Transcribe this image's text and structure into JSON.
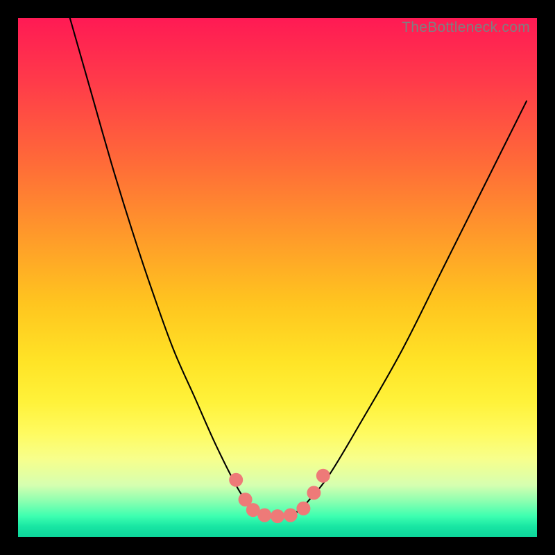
{
  "watermark": "TheBottleneck.com",
  "chart_data": {
    "type": "line",
    "title": "",
    "xlabel": "",
    "ylabel": "",
    "xlim": [
      0,
      100
    ],
    "ylim": [
      0,
      100
    ],
    "series": [
      {
        "name": "bottleneck-curve",
        "x": [
          10,
          14,
          18,
          22,
          26,
          30,
          34,
          38,
          42,
          44,
          46,
          48,
          50,
          52,
          54,
          56,
          60,
          66,
          74,
          82,
          90,
          98
        ],
        "values": [
          100,
          86,
          72,
          59,
          47,
          36,
          27,
          18,
          10,
          7,
          5,
          4,
          4,
          4,
          5,
          7,
          12,
          22,
          36,
          52,
          68,
          84
        ]
      }
    ],
    "markers": [
      {
        "name": "dot-left-1",
        "x": 42.0,
        "y": 11.0
      },
      {
        "name": "dot-left-2",
        "x": 43.8,
        "y": 7.2
      },
      {
        "name": "dot-left-3",
        "x": 45.3,
        "y": 5.2
      },
      {
        "name": "dot-mid-1",
        "x": 47.5,
        "y": 4.2
      },
      {
        "name": "dot-mid-2",
        "x": 50.0,
        "y": 4.0
      },
      {
        "name": "dot-mid-3",
        "x": 52.5,
        "y": 4.2
      },
      {
        "name": "dot-right-1",
        "x": 55.0,
        "y": 5.5
      },
      {
        "name": "dot-right-2",
        "x": 57.0,
        "y": 8.5
      },
      {
        "name": "dot-right-3",
        "x": 58.8,
        "y": 11.8
      }
    ],
    "colors": {
      "curve": "#000000",
      "marker": "#ee7a78",
      "gradient_top": "#ff1a54",
      "gradient_mid": "#ffe326",
      "gradient_bot": "#0dd69b"
    }
  }
}
